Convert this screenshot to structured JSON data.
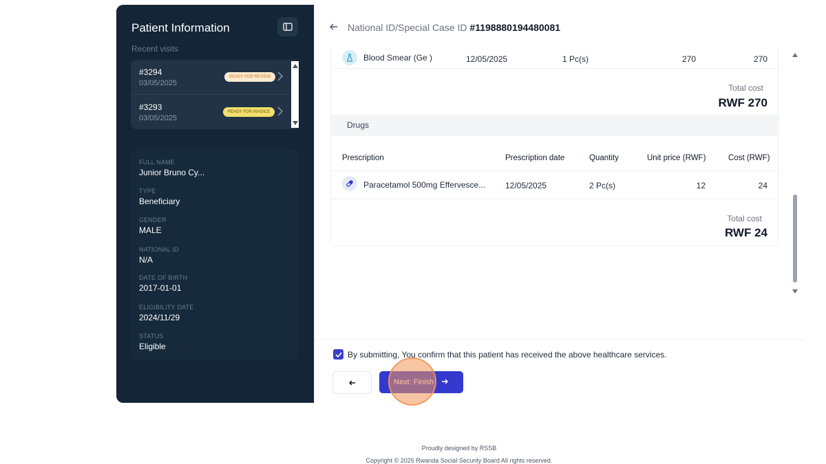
{
  "sidebar": {
    "title": "Patient Information",
    "toggle_icon": "sidebar-toggle-icon",
    "recent_label": "Recent visits",
    "visits": [
      {
        "id": "#3294",
        "date": "03/05/2025",
        "badge": "READY FOR REVIEW"
      },
      {
        "id": "#3293",
        "date": "03/05/2025",
        "badge": "READY FOR INVOICE"
      }
    ],
    "fields": [
      {
        "label": "FULL NAME",
        "value": "Junior Bruno Cy..."
      },
      {
        "label": "TYPE",
        "value": "Beneficiary"
      },
      {
        "label": "GENDER",
        "value": "MALE"
      },
      {
        "label": "NATIONAL ID",
        "value": "N/A"
      },
      {
        "label": "DATE OF BIRTH",
        "value": "2017-01-01"
      },
      {
        "label": "ELIGIBILITY DATE",
        "value": "2024/11/29"
      },
      {
        "label": "STATUS",
        "value": "Eligible"
      }
    ]
  },
  "header": {
    "case_label": "National ID/Special Case ID ",
    "case_id": "#1198880194480081"
  },
  "tests": {
    "row": {
      "name": "Blood Smear (Ge )",
      "date": "12/05/2025",
      "quantity": "1 Pc(s)",
      "unit_price": "270",
      "cost": "270"
    },
    "total_label": "Total cost",
    "total_value": "RWF 270"
  },
  "drugs": {
    "section_label": "Drugs",
    "columns": [
      "Prescription",
      "Prescription date",
      "Quantity",
      "Unit price (RWF)",
      "Cost (RWF)"
    ],
    "row": {
      "name": "Paracetamol 500mg Effervesce...",
      "date": "12/05/2025",
      "quantity": "2 Pc(s)",
      "unit_price": "12",
      "cost": "24"
    },
    "total_label": "Total cost",
    "total_value": "RWF 24"
  },
  "footer": {
    "confirm_text": "By submitting, You confirm that this patient has received the above healthcare services.",
    "next_label": "Next: Finish"
  },
  "page_footer": {
    "designed": "Proudly designed by RSSB",
    "copyright": "Copyright © 2025 Rwanda Social Security Board All rights reserved."
  },
  "colors": {
    "sidebar_bg": "#132536",
    "accent": "#3538cd",
    "review_badge": "#fde9cf",
    "invoice_badge": "#f3df6d"
  }
}
